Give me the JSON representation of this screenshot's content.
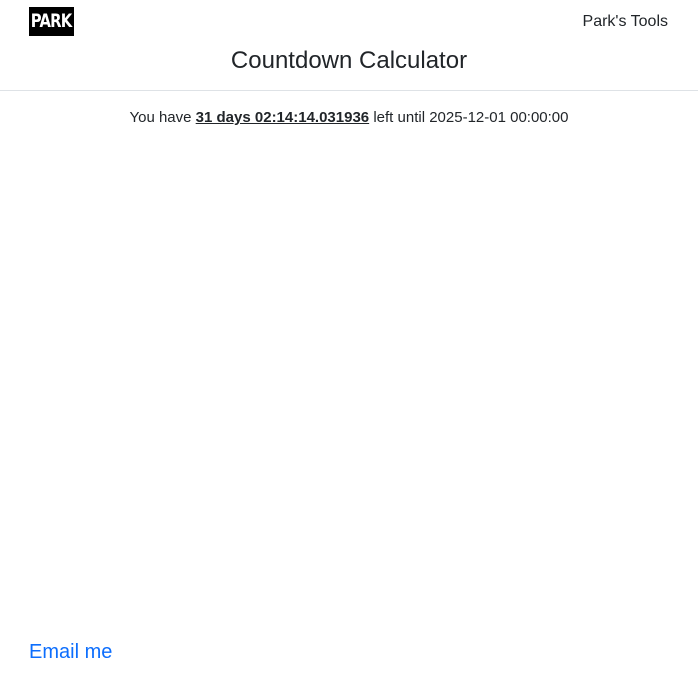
{
  "header": {
    "logo_text": "PARK",
    "nav_link": "Park's Tools",
    "title": "Countdown Calculator"
  },
  "countdown": {
    "prefix": "You have",
    "remaining": "31 days 02:14:14.031936",
    "middle": "left until",
    "target": "2025-12-01 00:00:00"
  },
  "footer": {
    "email_link": "Email me"
  },
  "colors": {
    "link": "#0d6efd",
    "text": "#212529",
    "divider": "#dee2e6",
    "logo_bg": "#000000"
  }
}
